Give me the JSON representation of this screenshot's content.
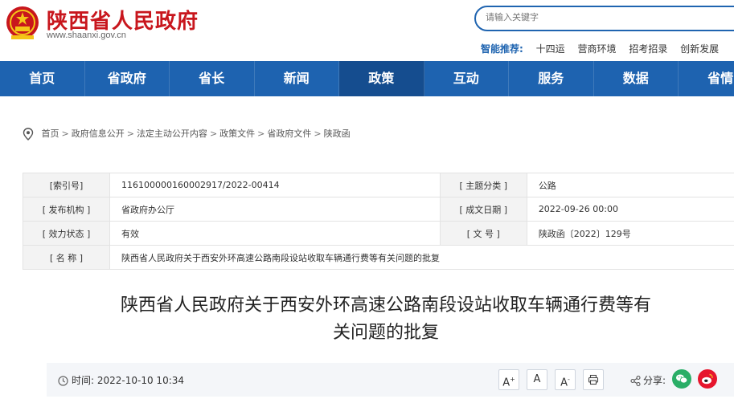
{
  "header": {
    "site_name": "陕西省人民政府",
    "site_url": "www.shaanxi.gov.cn",
    "search_placeholder": "请输入关键字",
    "smart_label": "智能推荐:",
    "smart_links": [
      "十四运",
      "营商环境",
      "招考招录",
      "创新发展"
    ]
  },
  "nav": {
    "items": [
      "首页",
      "省政府",
      "省长",
      "新闻",
      "政策",
      "互动",
      "服务",
      "数据",
      "省情"
    ],
    "active_index": 4
  },
  "breadcrumb": [
    "首页",
    "政府信息公开",
    "法定主动公开内容",
    "政策文件",
    "省政府文件",
    "陕政函"
  ],
  "meta": {
    "index_label": "[索引号]",
    "index_value": "116100000160002917/2022-00414",
    "topic_label": "[ 主题分类 ]",
    "topic_value": "公路",
    "issuer_label": "[ 发布机构 ]",
    "issuer_value": "省政府办公厅",
    "date_label": "[ 成文日期 ]",
    "date_value": "2022-09-26 00:00",
    "status_label": "[ 效力状态 ]",
    "status_value": "有效",
    "docno_label": "[ 文 号 ]",
    "docno_value": "陕政函〔2022〕129号",
    "name_label": "[ 名 称 ]",
    "name_value": "陕西省人民政府关于西安外环高速公路南段设站收取车辆通行费等有关问题的批复"
  },
  "article": {
    "title_line1": "陕西省人民政府关于西安外环高速公路南段设站收取车辆通行费等有",
    "title_line2": "关问题的批复",
    "time_label": "时间:",
    "time_value": "2022-10-10 10:34",
    "font_increase": "A",
    "font_reset": "A",
    "font_decrease": "A",
    "share_label": "分享:"
  },
  "colors": {
    "brand_red": "#c8161d",
    "nav_blue": "#1e63b0",
    "nav_active": "#154d8f",
    "wechat_green": "#2aae67",
    "weibo_red": "#e6162d"
  }
}
